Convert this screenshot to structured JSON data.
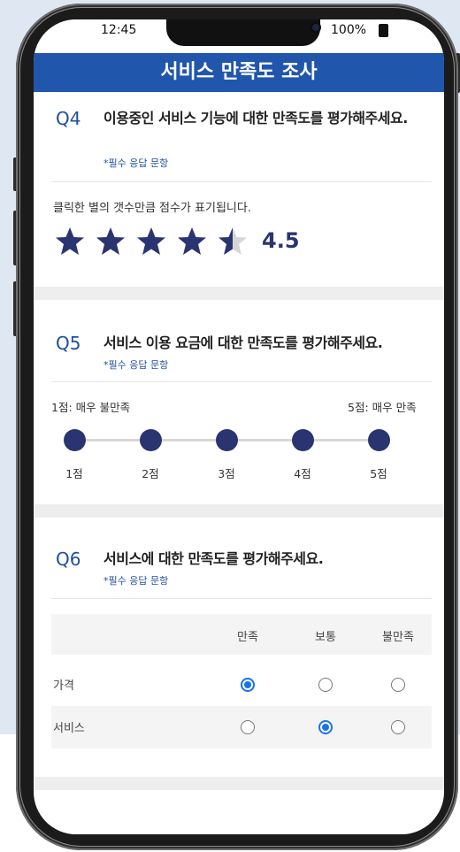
{
  "status": {
    "time": "12:45",
    "battery": "100%"
  },
  "header": {
    "title": "서비스 만족도 조사"
  },
  "q4": {
    "num": "Q4",
    "title": "이용중인 서비스 기능에 대한 만족도를 평가해주세요.",
    "required": "*필수 응답 문항",
    "hint": "클릭한 별의 갯수만큼 점수가 표기됩니다.",
    "rating": 4.5,
    "rating_text": "4.5",
    "max_stars": 5
  },
  "q5": {
    "num": "Q5",
    "title": "서비스 이용 요금에 대한 만족도를 평가해주세요.",
    "required": "*필수 응답 문항",
    "min_label": "1점: 매우 불만족",
    "max_label": "5점: 매우 만족",
    "points": [
      "1점",
      "2점",
      "3점",
      "4점",
      "5점"
    ]
  },
  "q6": {
    "num": "Q6",
    "title": "서비스에 대한 만족도를 평가해주세요.",
    "required": "*필수 응답 문항",
    "columns": [
      "만족",
      "보통",
      "불만족"
    ],
    "rows": [
      {
        "label": "가격",
        "selected": 0
      },
      {
        "label": "서비스",
        "selected": 1
      }
    ]
  },
  "colors": {
    "header": "#2156ad",
    "accent": "#2a3470",
    "radio": "#1a73e8"
  }
}
